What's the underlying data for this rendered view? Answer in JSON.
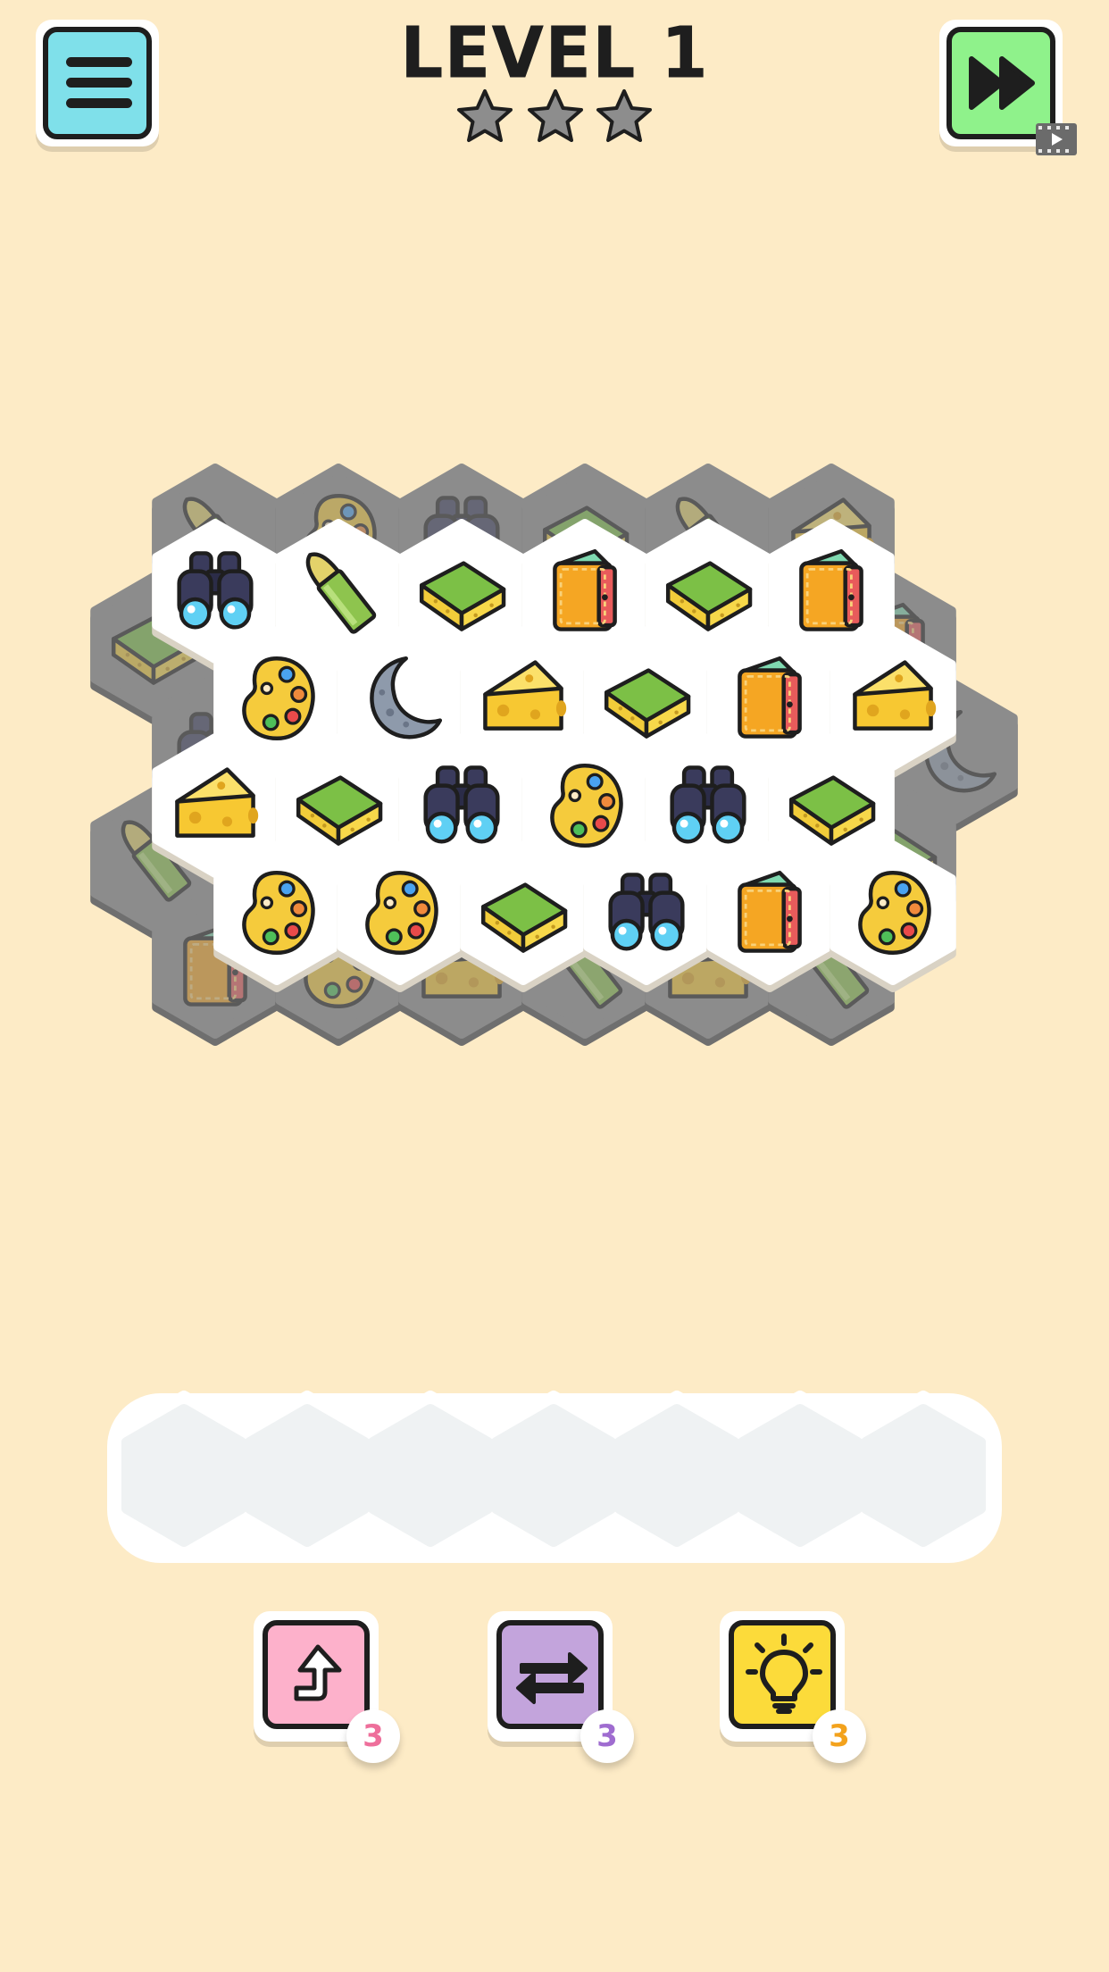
{
  "header": {
    "title": "LEVEL 1",
    "stars_earned": 0,
    "stars_total": 3,
    "menu_icon": "hamburger-menu-icon",
    "skip_icon": "fast-forward-icon",
    "skip_badge_icon": "video-ad-icon",
    "colors": {
      "menu": "#7fe0ea",
      "skip": "#8ff28b"
    }
  },
  "board": {
    "back_layer": [
      [
        "bullet",
        "palette",
        "binoculars",
        "sponge",
        "bullet",
        "cheese"
      ],
      [
        "sponge",
        "binoculars",
        "wallet",
        "moon"
      ],
      [
        "bullet",
        "bullet",
        "sponge"
      ],
      [
        "wallet",
        "palette",
        "cheese",
        "bullet",
        "cheese",
        "bullet"
      ]
    ],
    "front_layer": [
      [
        "binoculars",
        "bullet",
        "sponge",
        "wallet",
        "sponge",
        "wallet"
      ],
      [
        "palette",
        "moon",
        "cheese",
        "sponge",
        "wallet",
        "cheese"
      ],
      [
        "cheese",
        "sponge",
        "binoculars",
        "palette",
        "binoculars",
        "sponge"
      ],
      [
        "palette",
        "palette",
        "sponge",
        "binoculars",
        "wallet",
        "palette"
      ]
    ]
  },
  "tray": {
    "slots_total": 7,
    "slots_filled": 0
  },
  "powerups": [
    {
      "name": "undo",
      "icon": "undo-arrow-icon",
      "count": "3",
      "color": "#fdb1cb"
    },
    {
      "name": "shuffle",
      "icon": "shuffle-icon",
      "count": "3",
      "color": "#c3a4dc"
    },
    {
      "name": "hint",
      "icon": "lightbulb-icon",
      "count": "3",
      "color": "#fcdb3a"
    }
  ]
}
